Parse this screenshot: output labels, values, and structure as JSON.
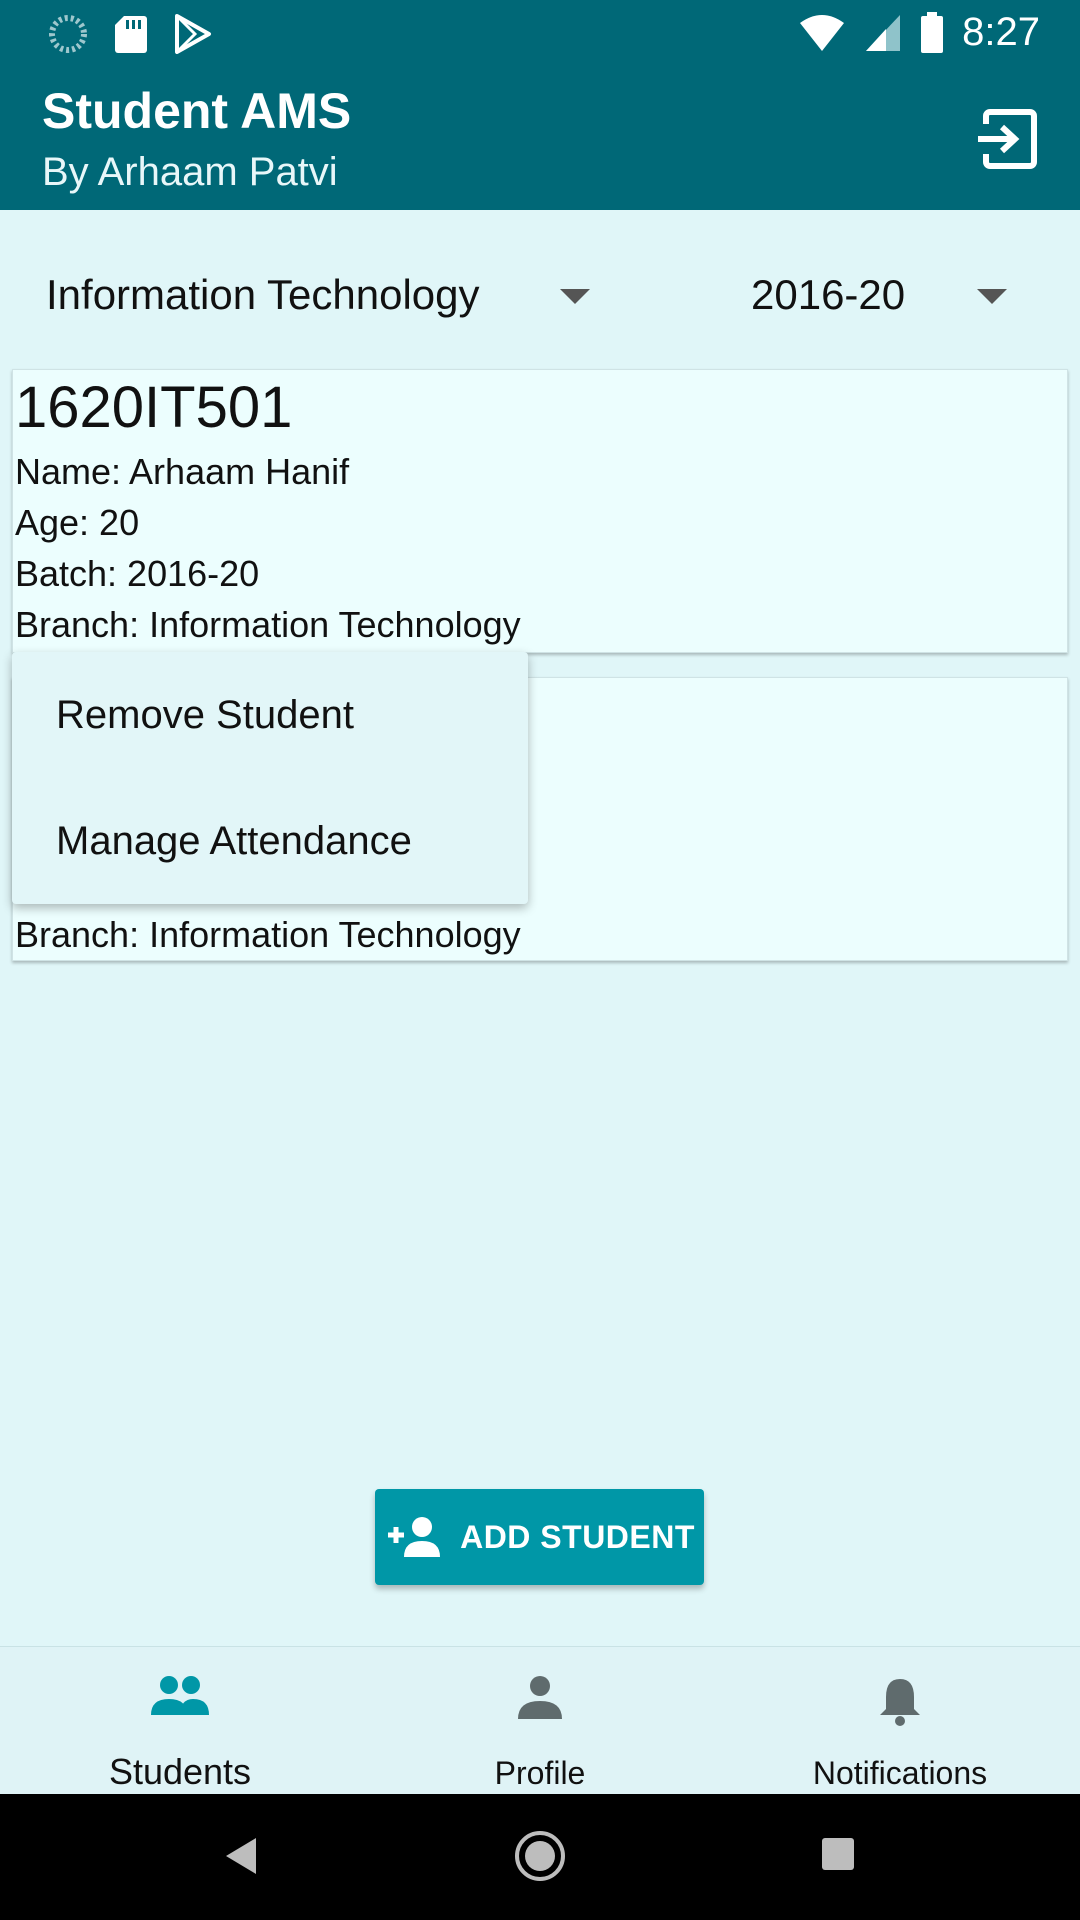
{
  "status_bar": {
    "time": "8:27",
    "icons": [
      "sync-icon",
      "sd-card-icon",
      "play-store-icon",
      "wifi-icon",
      "signal-icon",
      "battery-icon"
    ]
  },
  "app_bar": {
    "title": "Student AMS",
    "subtitle": "By Arhaam Patvi",
    "logout_icon": "logout-icon"
  },
  "filters": {
    "branch": "Information Technology",
    "batch": "2016-20"
  },
  "students": [
    {
      "id": "1620IT501",
      "name": "Name: Arhaam Hanif",
      "age": "Age: 20",
      "batch": "Batch: 2016-20",
      "branch": "Branch: Information Technology"
    },
    {
      "branch": "Branch: Information Technology"
    }
  ],
  "context_menu": {
    "items": [
      "Remove Student",
      "Manage Attendance"
    ]
  },
  "add_button": {
    "label": "ADD STUDENT",
    "icon": "add-person-icon"
  },
  "bottom_nav": {
    "items": [
      {
        "label": "Students",
        "icon": "people-icon",
        "active": true
      },
      {
        "label": "Profile",
        "icon": "person-icon",
        "active": false
      },
      {
        "label": "Notifications",
        "icon": "bell-icon",
        "active": false
      }
    ]
  },
  "colors": {
    "primary": "#006877",
    "accent": "#0097a7",
    "background": "#e0f6f8"
  }
}
